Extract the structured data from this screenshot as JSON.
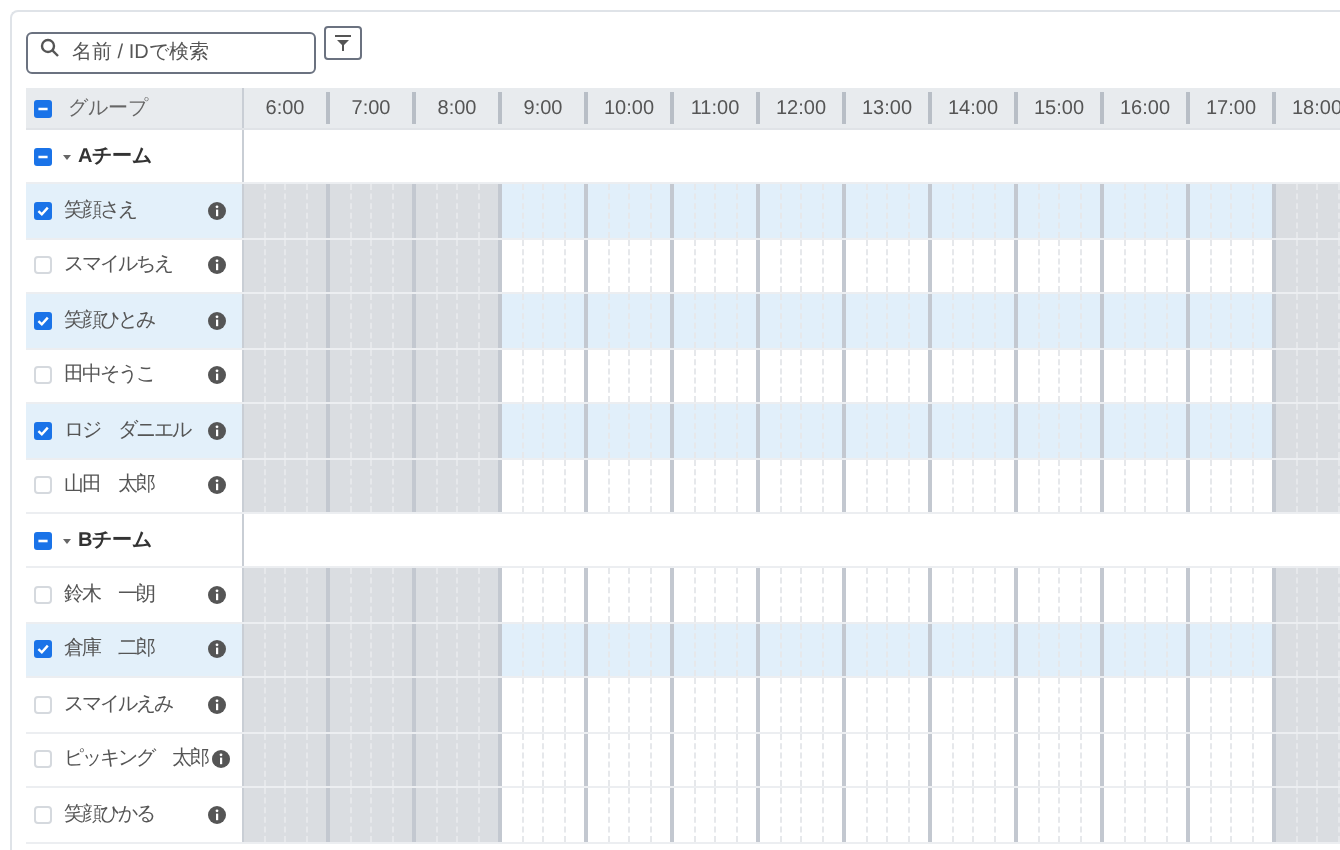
{
  "search": {
    "placeholder": "名前 / IDで検索"
  },
  "table": {
    "header": {
      "label": "グループ",
      "indeterminate": true
    },
    "hours": [
      {
        "label": "6:00",
        "off": true
      },
      {
        "label": "7:00",
        "off": true
      },
      {
        "label": "8:00",
        "off": true
      },
      {
        "label": "9:00",
        "off": false
      },
      {
        "label": "10:00",
        "off": false
      },
      {
        "label": "11:00",
        "off": false
      },
      {
        "label": "12:00",
        "off": false
      },
      {
        "label": "13:00",
        "off": false
      },
      {
        "label": "14:00",
        "off": false
      },
      {
        "label": "15:00",
        "off": false
      },
      {
        "label": "16:00",
        "off": false
      },
      {
        "label": "17:00",
        "off": false
      },
      {
        "label": "18:00",
        "off": true
      }
    ],
    "rows": [
      {
        "kind": "group",
        "name": "Aチーム",
        "indeterminate": true,
        "expanded": true
      },
      {
        "kind": "member",
        "name": "笑顔さえ",
        "checked": true
      },
      {
        "kind": "member",
        "name": "スマイルちえ",
        "checked": false
      },
      {
        "kind": "member",
        "name": "笑顔ひとみ",
        "checked": true
      },
      {
        "kind": "member",
        "name": "田中そうこ",
        "checked": false
      },
      {
        "kind": "member",
        "name": "ロジ　ダニエル",
        "checked": true
      },
      {
        "kind": "member",
        "name": "山田　太郎",
        "checked": false
      },
      {
        "kind": "group",
        "name": "Bチーム",
        "indeterminate": true,
        "expanded": true
      },
      {
        "kind": "member",
        "name": "鈴木　一朗",
        "checked": false
      },
      {
        "kind": "member",
        "name": "倉庫　二郎",
        "checked": true
      },
      {
        "kind": "member",
        "name": "スマイルえみ",
        "checked": false
      },
      {
        "kind": "member",
        "name": "ピッキング　太郎",
        "checked": false
      },
      {
        "kind": "member",
        "name": "笑顔ひかる",
        "checked": false
      }
    ]
  }
}
